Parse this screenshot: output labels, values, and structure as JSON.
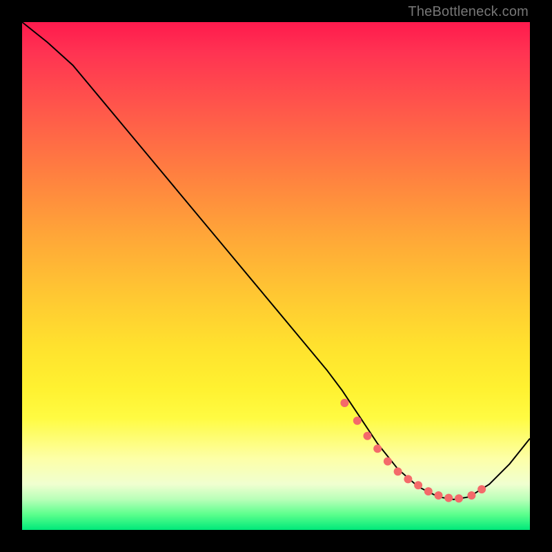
{
  "watermark": "TheBottleneck.com",
  "chart_data": {
    "type": "line",
    "title": "",
    "xlabel": "",
    "ylabel": "",
    "xlim": [
      0,
      100
    ],
    "ylim": [
      0,
      100
    ],
    "grid": false,
    "series": [
      {
        "name": "curve",
        "x": [
          0,
          5,
          10,
          15,
          20,
          25,
          30,
          35,
          40,
          45,
          50,
          55,
          60,
          63,
          66,
          70,
          74,
          78,
          82,
          85,
          88,
          92,
          96,
          100
        ],
        "y": [
          100,
          96,
          91.5,
          85.5,
          79.5,
          73.5,
          67.5,
          61.5,
          55.5,
          49.5,
          43.5,
          37.5,
          31.5,
          27.5,
          23,
          17,
          12,
          8.5,
          6.5,
          6,
          6.5,
          9,
          13,
          18
        ],
        "color": "#000000"
      }
    ],
    "markers": {
      "name": "dots",
      "x": [
        63.5,
        66,
        68,
        70,
        72,
        74,
        76,
        78,
        80,
        82,
        84,
        86,
        88.5,
        90.5
      ],
      "y": [
        25,
        21.5,
        18.5,
        16,
        13.5,
        11.5,
        10,
        8.8,
        7.6,
        6.8,
        6.3,
        6.2,
        6.8,
        8
      ],
      "color": "#f46a6a",
      "size": 6
    }
  }
}
